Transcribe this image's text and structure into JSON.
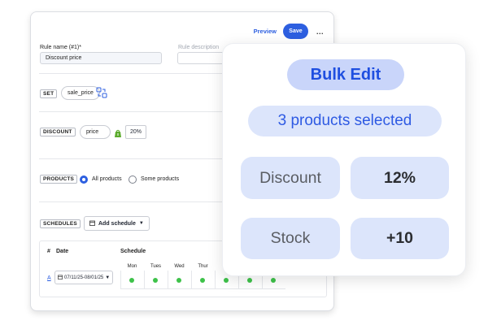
{
  "header": {
    "preview_label": "Preview",
    "save_label": "Save",
    "more_label": "..."
  },
  "rule_form": {
    "name_label": "Rule name (#1)*",
    "name_value": "Discount price",
    "description_label": "Rule description",
    "description_value": ""
  },
  "set_section": {
    "tag": "SET",
    "field": "sale_price",
    "icon": "swap-icon"
  },
  "discount_section": {
    "tag": "DISCOUNT",
    "field": "price",
    "icon": "shopify-icon",
    "value": "20%"
  },
  "products_section": {
    "tag": "PRODUCTS",
    "options": [
      "All products",
      "Some products"
    ],
    "selected": "All products"
  },
  "schedules_section": {
    "tag": "SCHEDULES",
    "add_label": "Add schedule",
    "table": {
      "headers": [
        "#",
        "Date",
        "Schedule"
      ],
      "days": [
        "Mon",
        "Tues",
        "Wed",
        "Thur"
      ],
      "rows": [
        {
          "index": "A",
          "date": "07/11/25-08/01/25",
          "active_days": 7
        }
      ]
    }
  },
  "bulk_edit": {
    "title": "Bulk Edit",
    "selection": "3 products selected",
    "fields": [
      {
        "name": "Discount",
        "value": "12%"
      },
      {
        "name": "Stock",
        "value": "+10"
      }
    ]
  },
  "colors": {
    "accent": "#2d5fe0",
    "pill_bg": "#dce5fb",
    "title_pill_bg": "#c9d5fa",
    "dot_green": "#3ec24a"
  }
}
